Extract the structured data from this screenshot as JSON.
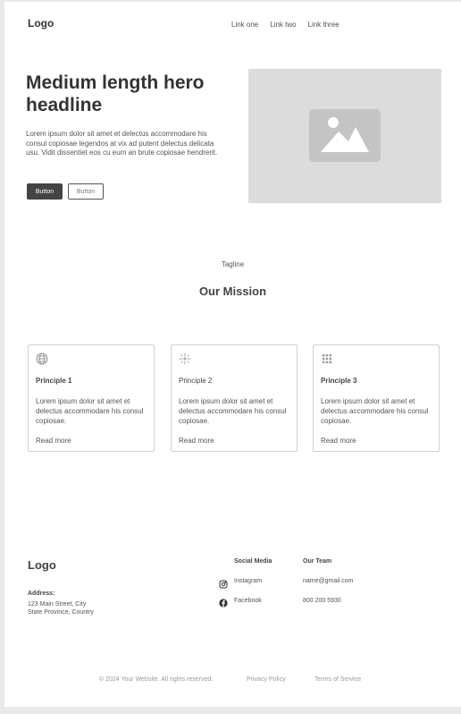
{
  "navbar": {
    "logo": "Logo",
    "links": [
      "Link one",
      "Link two",
      "Link three"
    ]
  },
  "hero": {
    "headline": "Medium length hero headline",
    "body": "Lorem ipsum dolor sit amet et delectus accommodare his consul copiosae legendos at vix ad putent delectus delicata usu. Vidit dissentiet eos cu eum an brute copiosae hendrerit.",
    "primary_button": "Button",
    "secondary_button": "Button",
    "image_icon": "image-placeholder-icon"
  },
  "mission": {
    "tagline": "Tagline",
    "title": "Our Mission",
    "cards": [
      {
        "icon": "globe-icon",
        "title": "Principle 1",
        "body": "Lorem ipsum dolor sit amet et delectus accommodare his consul copiosae.",
        "link": "Read more"
      },
      {
        "icon": "sparkle-icon",
        "title": "Principle 2",
        "body": "Lorem ipsum dolor sit amet et delectus accommodare his consul copiosae.",
        "link": "Read more"
      },
      {
        "icon": "grid-dots-icon",
        "title": "Principle 3",
        "body": "Lorem ipsum dolor sit amet et delectus accommodare his consul copiosae.",
        "link": "Read more"
      }
    ]
  },
  "footer": {
    "logo": "Logo",
    "address_label": "Address:",
    "address_lines": [
      "123 Main Street, City",
      "State Province, Country"
    ],
    "social": {
      "heading": "Social Media",
      "items": [
        {
          "icon": "instagram-icon",
          "label": "Instagram"
        },
        {
          "icon": "facebook-icon",
          "label": "Facebook"
        }
      ]
    },
    "team": {
      "heading": "Our Team",
      "items": [
        "name@gmail.com",
        "800 200 5930"
      ]
    },
    "copyright": "© 2024 Your Website. All rights reserved.",
    "legal_links": [
      "Privacy Policy",
      "Terms of Service"
    ]
  },
  "colors": {
    "page_background": "#ffffff",
    "canvas_background": "#e9e9e9",
    "primary_button": "#444444",
    "image_placeholder": "#dcdcdc"
  }
}
